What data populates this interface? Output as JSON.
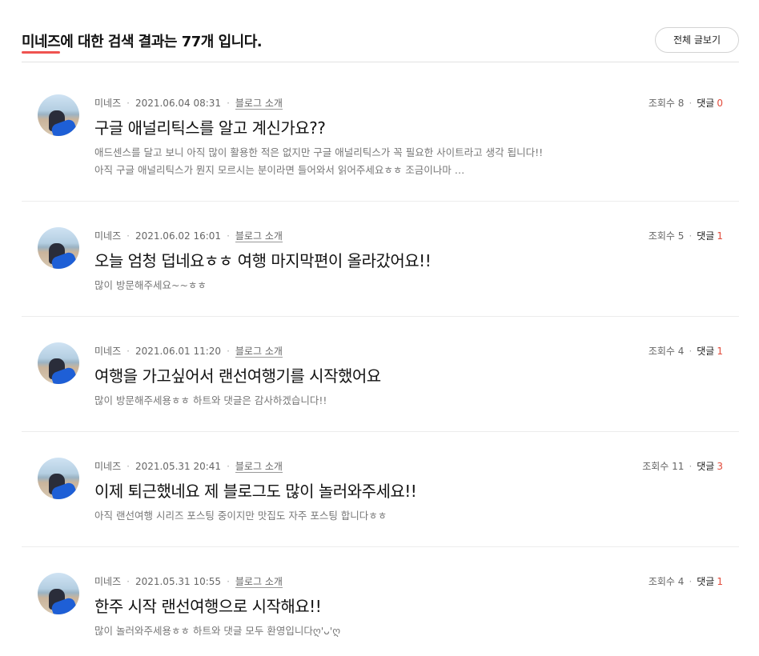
{
  "search": {
    "keyword": "미네즈",
    "title_suffix": "에 대한 검색 결과는 77개 입니다.",
    "view_all_label": "전체 글보기"
  },
  "labels": {
    "views": "조회수",
    "comments": "댓글",
    "separator": "·"
  },
  "posts": [
    {
      "author": "미네즈",
      "date": "2021.06.04 08:31",
      "category": "블로그 소개",
      "views": "8",
      "comments": "0",
      "title": "구글 애널리틱스를 알고 계신가요??",
      "excerpt": "애드센스를 달고 보니 아직 많이 활용한 적은 없지만 구글 애널리틱스가 꼭 필요한 사이트라고 생각 됩니다!! 아직 구글 애널리틱스가 뭔지 모르시는 분이라면 들어와서 읽어주세요ㅎㅎ 조금이나마 …"
    },
    {
      "author": "미네즈",
      "date": "2021.06.02 16:01",
      "category": "블로그 소개",
      "views": "5",
      "comments": "1",
      "title": "오늘 엄청 덥네요ㅎㅎ 여행 마지막편이 올라갔어요!!",
      "excerpt": "많이 방문해주세요~~ㅎㅎ"
    },
    {
      "author": "미네즈",
      "date": "2021.06.01 11:20",
      "category": "블로그 소개",
      "views": "4",
      "comments": "1",
      "title": "여행을 가고싶어서 랜선여행기를 시작했어요",
      "excerpt": "많이 방문해주세용ㅎㅎ 하트와 댓글은 감사하겠습니다!!"
    },
    {
      "author": "미네즈",
      "date": "2021.05.31 20:41",
      "category": "블로그 소개",
      "views": "11",
      "comments": "3",
      "title": "이제 퇴근했네요 제 블로그도 많이 놀러와주세요!!",
      "excerpt": "아직 랜선여행 시리즈 포스팅 중이지만 맛집도 자주 포스팅 합니다ㅎㅎ"
    },
    {
      "author": "미네즈",
      "date": "2021.05.31 10:55",
      "category": "블로그 소개",
      "views": "4",
      "comments": "1",
      "title": "한주 시작 랜선여행으로 시작해요!!",
      "excerpt": "많이 놀러와주세용ㅎㅎ 하트와 댓글 모두 환영입니다ღ'ᴗ'ღ"
    }
  ]
}
